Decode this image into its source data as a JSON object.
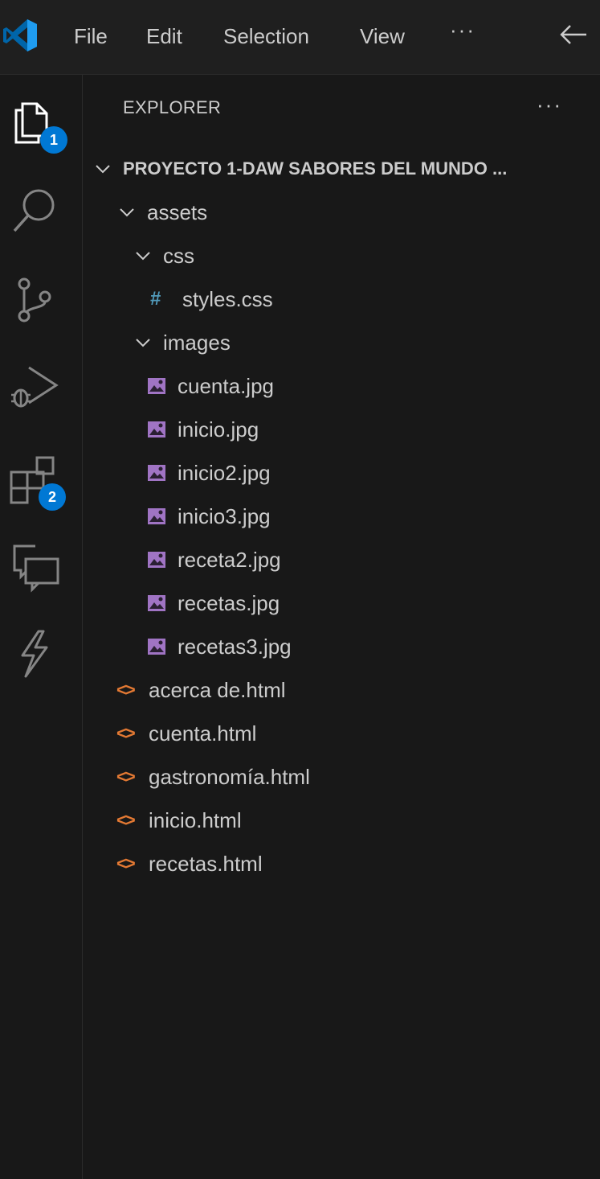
{
  "menu": {
    "file": "File",
    "edit": "Edit",
    "selection": "Selection",
    "view": "View",
    "more": "···"
  },
  "activity_bar": {
    "explorer_badge": "1",
    "extensions_badge": "2",
    "accent_color": "#0078d4",
    "icons": [
      "files-icon",
      "search-icon",
      "source-control-icon",
      "run-debug-icon",
      "extensions-icon",
      "remote-explorer-icon",
      "lightning-icon"
    ]
  },
  "explorer": {
    "title": "EXPLORER",
    "more": "···",
    "root": "PROYECTO 1-DAW SABORES DEL MUNDO ...",
    "assets": "assets",
    "css": "css",
    "styles": "styles.css",
    "images": "images",
    "image_files": [
      "cuenta.jpg",
      "inicio.jpg",
      "inicio2.jpg",
      "inicio3.jpg",
      "receta2.jpg",
      "recetas.jpg",
      "recetas3.jpg"
    ],
    "html_files": [
      "acerca de.html",
      "cuenta.html",
      "gastronomía.html",
      "inicio.html",
      "recetas.html"
    ]
  }
}
